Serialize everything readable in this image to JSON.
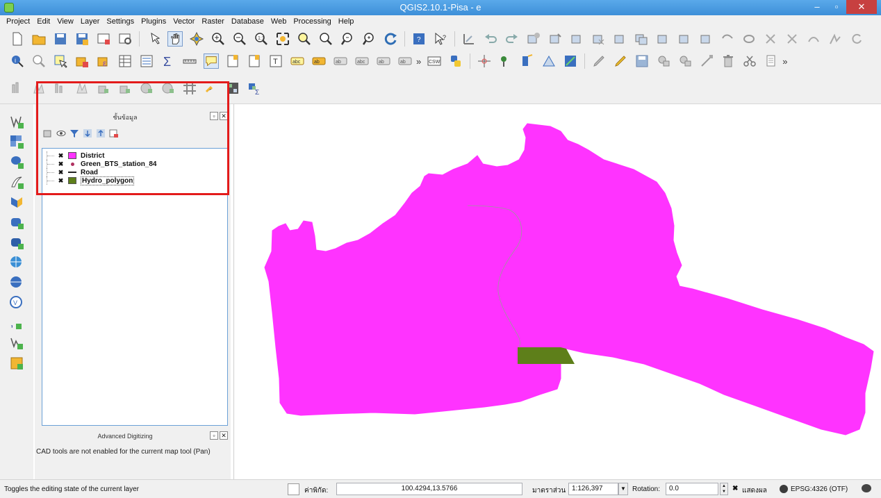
{
  "window": {
    "title": "QGIS2.10.1-Pisa - e",
    "minimize": "–",
    "maximize": "▫",
    "close": "✕"
  },
  "menu": [
    "Project",
    "Edit",
    "View",
    "Layer",
    "Settings",
    "Plugins",
    "Vector",
    "Raster",
    "Database",
    "Web",
    "Processing",
    "Help"
  ],
  "toolbar_overflow": "»",
  "layers_panel": {
    "title": "ชั้นข้อมูล",
    "float_button": "▫",
    "close_button": "✕",
    "layers": [
      {
        "name": "District",
        "checked": "✖",
        "symbol": "fill",
        "color": "#ff33ff"
      },
      {
        "name": "Green_BTS_station_84",
        "checked": "✖",
        "symbol": "point",
        "color": "#b03060"
      },
      {
        "name": "Road",
        "checked": "✖",
        "symbol": "line",
        "color": "#222222"
      },
      {
        "name": "Hydro_polygon",
        "checked": "✖",
        "symbol": "fill",
        "color": "#5e7f1a"
      }
    ]
  },
  "advanced_digitizing": {
    "title": "Advanced Digitizing",
    "message": "CAD tools are not enabled for the current map tool (Pan)"
  },
  "map": {
    "district_color": "#ff33ff",
    "hydro_color": "#5e7f1a",
    "boundary_color": "#9a9a9a"
  },
  "status": {
    "message": "Toggles the editing state of the current layer",
    "coordinate_label": "ค่าพิกัด:",
    "coordinate_value": "100.4294,13.5766",
    "scale_label": "มาตราส่วน",
    "scale_value": "1:126,397",
    "rotation_label": "Rotation:",
    "rotation_value": "0.0",
    "render_checked": "✖",
    "render_label": "แสดงผล",
    "crs_label": "EPSG:4326 (OTF)"
  }
}
